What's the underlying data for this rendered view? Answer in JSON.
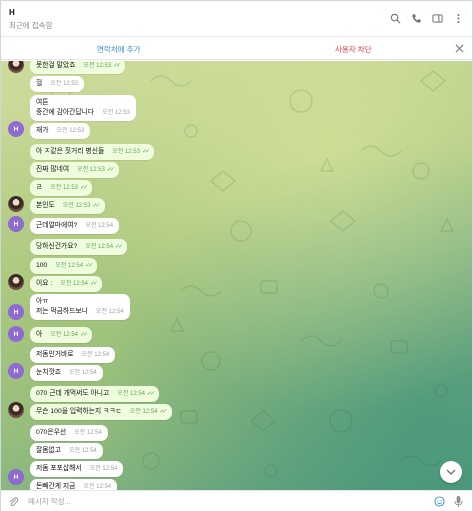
{
  "header": {
    "name": "H",
    "status": "최근에 접속함"
  },
  "actions": {
    "add_contact": "연락처에 추가",
    "block_user": "사용자 차단"
  },
  "composer": {
    "placeholder": "메시지 작성..."
  },
  "messages": [
    {
      "text": "못한걸 말았죠",
      "time": "오전 12:53",
      "ticks": true
    },
    {
      "text": "헐",
      "time": "오전 12:53",
      "ticks": false
    },
    {
      "text": "여튼",
      "text2": "중간에 감아간답니다",
      "time": "오전 12:53",
      "ticks": false
    },
    {
      "text": "재가",
      "time": "오전 12:53",
      "ticks": false
    },
    {
      "text": "아 ㅈ같은 짓거리 병신들",
      "time": "오전 12:53",
      "ticks": true
    },
    {
      "text": "진짜 많네여",
      "time": "오전 12:53",
      "ticks": true
    },
    {
      "text": "ㄹ",
      "time": "오전 12:53",
      "ticks": true
    },
    {
      "text": "본인도",
      "time": "오전 12:53",
      "ticks": true
    },
    {
      "text": "근데얼마에여?",
      "time": "오전 12:54",
      "ticks": false
    },
    {
      "text": "당하신건가요?",
      "time": "오전 12:54",
      "ticks": true
    },
    {
      "text": "100",
      "time": "오전 12:54",
      "ticks": true
    },
    {
      "text": "이요 :",
      "time": "오전 12:54",
      "ticks": true
    },
    {
      "text": "아ㅠ",
      "text2": "저는 먹금하드보니",
      "time": "오전 12:54",
      "ticks": false
    },
    {
      "text": "아",
      "time": "오전 12:54",
      "ticks": true
    },
    {
      "text": "저돔인거바로",
      "time": "오전 12:54",
      "ticks": false
    },
    {
      "text": "눈치깟죠",
      "time": "오전 12:54",
      "ticks": false
    },
    {
      "text": "070 근데 개먹써도 아니고",
      "time": "오전 12:54",
      "ticks": true
    },
    {
      "text": "무슨 100을 입력하는지 ㅋㅋㄷ",
      "time": "오전 12:54",
      "ticks": true
    },
    {
      "text": "070은우선",
      "time": "오전 12:54",
      "ticks": false
    },
    {
      "text": "잘몸없고",
      "time": "오전 12:54",
      "ticks": false
    },
    {
      "text": "저돔 포포삽해서",
      "time": "오전 12:54",
      "ticks": false
    },
    {
      "text": "돈빼간게 지금",
      "time": "오전 12:54",
      "ticks": false
    }
  ],
  "avatars": {
    "initial": "H"
  },
  "colors": {
    "accent": "#3390d8",
    "danger": "#e0393e",
    "bubble_out": "#effdde",
    "bubble_in": "#ffffff",
    "avatar_h": "#8e6ad1"
  },
  "icons": [
    "search-icon",
    "phone-icon",
    "sidebar-icon",
    "more-icon",
    "close-icon",
    "attach-icon",
    "emoji-icon",
    "mic-icon",
    "chevron-down-icon",
    "double-check-icon"
  ]
}
